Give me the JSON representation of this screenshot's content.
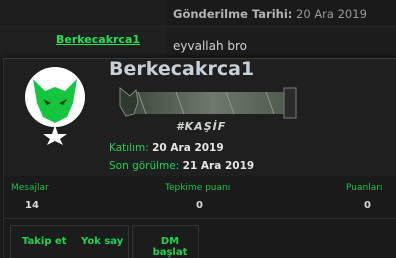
{
  "post": {
    "date_label": "Gönderilme Tarihi:",
    "date_value": "20 Ara 2019",
    "author_name": "Berkecakrca1",
    "message": "eyvallah bro"
  },
  "member_card": {
    "username": "Berkecakrca1",
    "banner_text": "#KAŞİF",
    "joined_label": "Katılım:",
    "joined_value": "20 Ara 2019",
    "last_seen_label": "Son görülme:",
    "last_seen_value": "21 Ara 2019",
    "stats": [
      {
        "label": "Mesajlar",
        "value": "14"
      },
      {
        "label": "Tepkime puanı",
        "value": "0"
      },
      {
        "label": "Puanları",
        "value": "0"
      }
    ],
    "actions": {
      "follow": "Takip et",
      "ignore": "Yok say",
      "dm": "DM başlat"
    }
  },
  "colors": {
    "accent": "#1fd355",
    "background": "#1a1a1a",
    "name_text": "#c8d1d8"
  }
}
